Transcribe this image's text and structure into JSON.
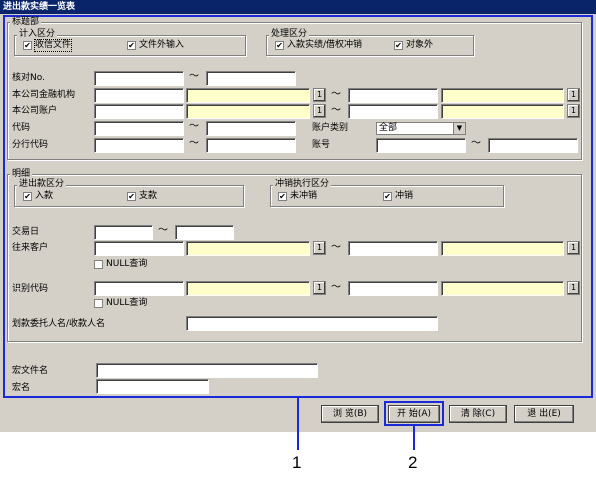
{
  "window": {
    "title": "进出款实绩一览表"
  },
  "header_group": {
    "label": "标题部",
    "input_type": {
      "label": "计入区分",
      "options": [
        {
          "label": "收信文件",
          "checked": true
        },
        {
          "label": "文件外输入",
          "checked": true
        }
      ]
    },
    "process_type": {
      "label": "处理区分",
      "options": [
        {
          "label": "入款实绩/借权冲销",
          "checked": true
        },
        {
          "label": "对象外",
          "checked": true
        }
      ]
    },
    "fields": {
      "check_no": "核对No.",
      "bank": "本公司金融机构",
      "account": "本公司账户",
      "code": "代码",
      "branch_code": "分行代码",
      "account_type": "账户类别",
      "account_no": "账号"
    },
    "account_type_value": "全部"
  },
  "detail_group": {
    "label": "明细",
    "inout_type": {
      "label": "进出款区分",
      "options": [
        {
          "label": "入款",
          "checked": true
        },
        {
          "label": "支款",
          "checked": true
        }
      ]
    },
    "offset_type": {
      "label": "冲销执行区分",
      "options": [
        {
          "label": "未冲销",
          "checked": true
        },
        {
          "label": "冲销",
          "checked": true
        }
      ]
    },
    "fields": {
      "trade_date": "交易日",
      "customer": "往来客户",
      "null_query": "NULL查询",
      "id_code": "识别代码",
      "payer_name": "划款委托人名/收款人名"
    }
  },
  "macro": {
    "file_label": "宏文件名",
    "name_label": "宏名"
  },
  "symbols": {
    "tilde": "～",
    "lookup": "1",
    "check": "✔"
  },
  "buttons": {
    "browse": "浏 览(B)",
    "start": "开 始(A)",
    "clear": "清 除(C)",
    "exit": "退 出(E)"
  },
  "callouts": {
    "one": "1",
    "two": "2"
  },
  "colors": {
    "highlight": "#1a2ad6",
    "title_bar": "#0a246a",
    "yellow_field": "#ffffcc"
  }
}
